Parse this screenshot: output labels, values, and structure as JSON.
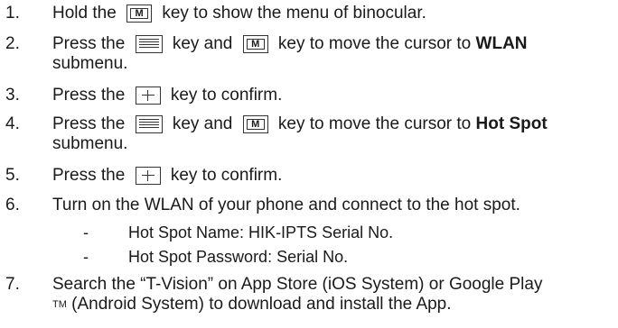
{
  "steps": [
    {
      "number": "1.",
      "lines": [
        {
          "before": "Hold the ",
          "key": "m-key-icon",
          "after": " key to show the menu of binocular."
        }
      ]
    },
    {
      "number": "2.",
      "lines": [
        {
          "before": "Press the ",
          "key1": "menu-key-icon",
          "middle": " key and ",
          "key2": "m-key-icon",
          "after": " key to move the cursor to ",
          "bold": "WLAN"
        },
        {
          "text": "submenu."
        }
      ]
    },
    {
      "number": "3.",
      "lines": [
        {
          "before": "Press the ",
          "key": "plus-key-icon",
          "after": " key to confirm."
        }
      ]
    },
    {
      "number": "4.",
      "lines": [
        {
          "before": "Press the ",
          "key1": "menu-key-icon",
          "middle": " key and ",
          "key2": "m-key-icon",
          "after": " key to move the cursor to ",
          "bold": "Hot Spot"
        },
        {
          "text": "submenu."
        }
      ]
    },
    {
      "number": "5.",
      "lines": [
        {
          "before": "Press the ",
          "key": "plus-key-icon",
          "after": " key to confirm."
        }
      ]
    },
    {
      "number": "6.",
      "lines": [
        {
          "text": "Turn on the WLAN of your phone and connect to the hot spot."
        }
      ],
      "subitems": [
        {
          "dash": "-",
          "text": "Hot Spot Name: HIK-IPTS Serial No."
        },
        {
          "dash": "-",
          "text": "Hot Spot Password: Serial No."
        }
      ]
    },
    {
      "number": "7.",
      "lines": [
        {
          "text": "Search the “T-Vision” on App Store (iOS System) or Google Play"
        },
        {
          "tm": "TM",
          "text": " (Android System) to download and install the App."
        }
      ]
    }
  ],
  "key_labels": {
    "m": "M"
  }
}
